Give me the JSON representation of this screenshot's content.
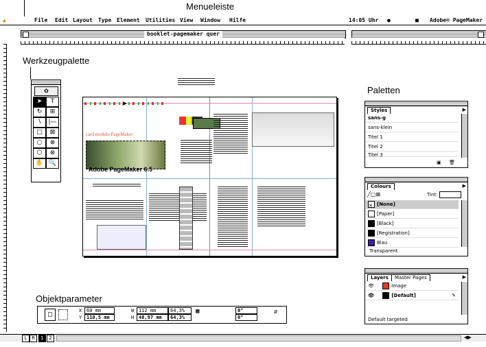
{
  "captions": {
    "menubar": "Menueleiste",
    "toolbox": "Werkzeugpalette",
    "palettes": "Paletten",
    "control": "Objektparameter"
  },
  "menubar": {
    "items": [
      "File",
      "Edit",
      "Layout",
      "Type",
      "Element",
      "Utilities",
      "View",
      "Window",
      "Hilfe"
    ],
    "clock": "14:05 Uhr",
    "app": "Adobe® PageMaker"
  },
  "window": {
    "title": "booklet-pagemaker quer"
  },
  "spread": {
    "brand_small": "card module  PageMaker",
    "brand_big": "Adobe PageMaker 6.5"
  },
  "styles": {
    "tab": "Styles",
    "items": [
      "sans-g",
      "sans-klein",
      "Titel 1",
      "Titel 2",
      "Titel 3"
    ]
  },
  "colours": {
    "tab": "Colours",
    "tint_label": "Tint:",
    "items": [
      "[None]",
      "[Paper]",
      "[Black]",
      "[Registration]",
      "Blau"
    ],
    "footer": "Transparent",
    "swatch_colors": [
      "#ffffff",
      "#ffffff",
      "#000000",
      "#000000",
      "#3a1fa0"
    ]
  },
  "layers": {
    "tabs": [
      "Layers",
      "Master Pages"
    ],
    "items": [
      "Image",
      "[Default]"
    ],
    "footer": "Default targeted",
    "colors": [
      "#e04020",
      "#000000"
    ]
  },
  "control": {
    "x": "60 mm",
    "y": "110,5 mm",
    "w": "112 mm",
    "h": "48,97 mm",
    "sx": "64,3%",
    "sy": "64,3%",
    "r": "0°",
    "k": "0°"
  },
  "pages": [
    "L",
    "R",
    "1",
    "2"
  ]
}
